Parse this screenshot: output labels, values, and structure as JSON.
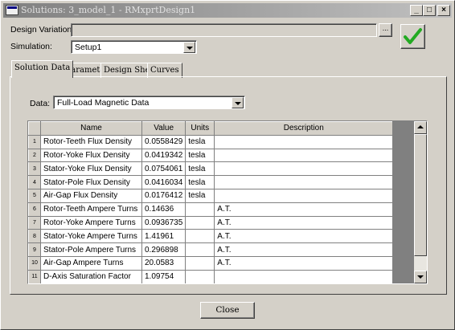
{
  "window": {
    "title": "Solutions: 3_model_1 - RMxprtDesign1",
    "minimize_glyph": "_",
    "maximize_glyph": "□",
    "close_glyph": "×"
  },
  "design_variation": {
    "label": "Design Variation:",
    "value": "",
    "browse_label": "..."
  },
  "simulation": {
    "label": "Simulation:",
    "selected": "Setup1"
  },
  "ok_icon": {
    "name": "green-checkmark-icon",
    "color": "#22aa22"
  },
  "tabs": [
    {
      "label": "Solution Data",
      "active": true
    },
    {
      "label": "Parameter",
      "active": false
    },
    {
      "label": "Design Sheet",
      "active": false
    },
    {
      "label": "Curves",
      "active": false
    }
  ],
  "data_select": {
    "label": "Data:",
    "selected": "Full-Load Magnetic Data"
  },
  "table": {
    "columns": [
      "",
      "Name",
      "Value",
      "Units",
      "Description"
    ],
    "rows": [
      {
        "num": "1",
        "name": "Rotor-Teeth Flux Density",
        "value": "0.0558429",
        "units": "tesla",
        "description": ""
      },
      {
        "num": "2",
        "name": "Rotor-Yoke Flux Density",
        "value": "0.0419342",
        "units": "tesla",
        "description": ""
      },
      {
        "num": "3",
        "name": "Stator-Yoke Flux Density",
        "value": "0.0754061",
        "units": "tesla",
        "description": ""
      },
      {
        "num": "4",
        "name": "Stator-Pole Flux Density",
        "value": "0.0416034",
        "units": "tesla",
        "description": ""
      },
      {
        "num": "5",
        "name": "Air-Gap Flux Density",
        "value": "0.0176412",
        "units": "tesla",
        "description": ""
      },
      {
        "num": "6",
        "name": "Rotor-Teeth Ampere Turns",
        "value": "0.14636",
        "units": "",
        "description": "A.T."
      },
      {
        "num": "7",
        "name": "Rotor-Yoke Ampere Turns",
        "value": "0.0936735",
        "units": "",
        "description": "A.T."
      },
      {
        "num": "8",
        "name": "Stator-Yoke Ampere Turns",
        "value": "1.41961",
        "units": "",
        "description": "A.T."
      },
      {
        "num": "9",
        "name": "Stator-Pole Ampere Turns",
        "value": "0.296898",
        "units": "",
        "description": "A.T."
      },
      {
        "num": "10",
        "name": "Air-Gap Ampere Turns",
        "value": "20.0583",
        "units": "",
        "description": "A.T."
      },
      {
        "num": "11",
        "name": "D-Axis Saturation Factor",
        "value": "1.09754",
        "units": "",
        "description": ""
      }
    ]
  },
  "close_button": {
    "label": "Close"
  }
}
